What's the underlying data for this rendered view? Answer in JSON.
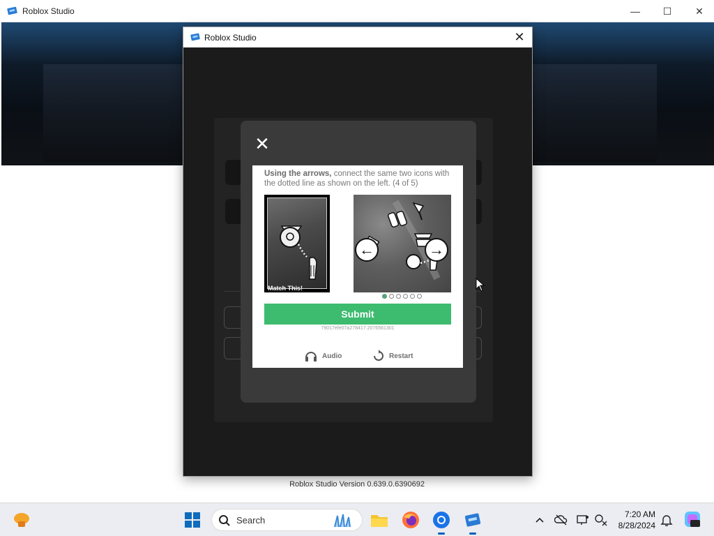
{
  "outer_window": {
    "title": "Roblox Studio",
    "controls": {
      "minimize": "—",
      "maximize": "☐",
      "close": "✕"
    }
  },
  "version_text": "Roblox Studio Version 0.639.0.6390692",
  "dialog": {
    "title": "Roblox Studio",
    "close": "✕"
  },
  "captcha": {
    "close": "✕",
    "instruction_bold": "Using the arrows,",
    "instruction_rest": " connect the same two icons with the dotted line as shown on the left. (4 of 5)",
    "match_label": "Match This!",
    "arrow_left": "←",
    "arrow_right": "→",
    "progress": {
      "total": 6,
      "current": 1
    },
    "submit_label": "Submit",
    "session_id": "79017efe07a278417.2076561301",
    "audio_label": "Audio",
    "restart_label": "Restart"
  },
  "taskbar": {
    "search_placeholder": "Search",
    "time": "7:20 AM",
    "date": "8/28/2024",
    "colors": {
      "accent": "#005fb8",
      "submit_green": "#3dbb6f"
    }
  }
}
